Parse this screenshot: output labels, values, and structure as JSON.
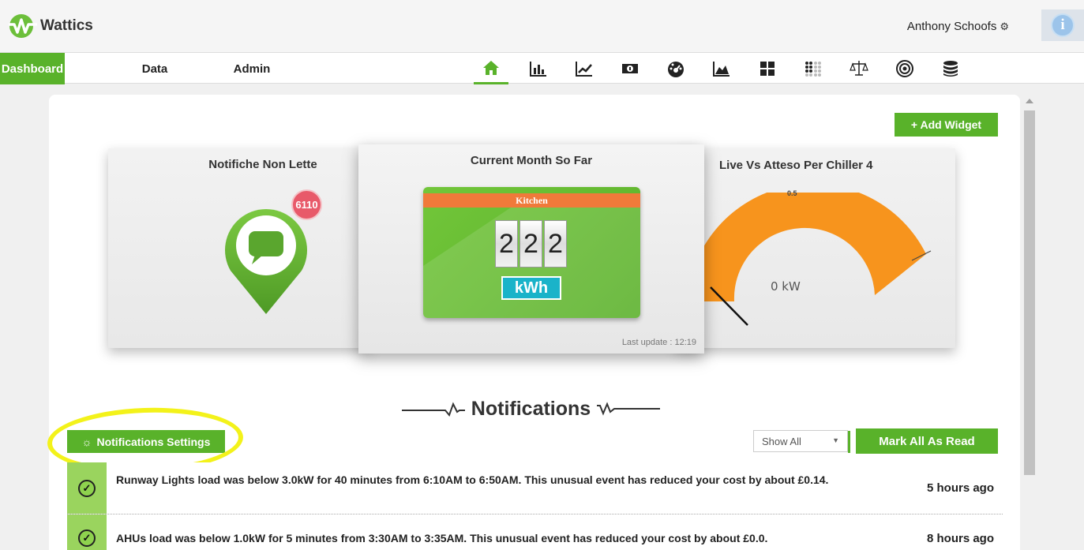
{
  "app": {
    "name": "Wattics"
  },
  "user": {
    "name": "Anthony Schoofs"
  },
  "colors": {
    "brand_green": "#59b22a",
    "accent_orange": "#f7941d",
    "badge_red": "#e85a6a",
    "unit_cyan": "#1ab3c9"
  },
  "nav": {
    "tabs": [
      {
        "label": "Dashboard",
        "active": true
      },
      {
        "label": "Data",
        "active": false
      },
      {
        "label": "Admin",
        "active": false
      }
    ],
    "icons": [
      "home-icon",
      "bar-chart-icon",
      "line-chart-icon",
      "money-icon",
      "dashboard-icon",
      "area-chart-icon",
      "grid-icon",
      "dots-grid-icon",
      "balance-scale-icon",
      "target-icon",
      "database-icon"
    ]
  },
  "toolbar": {
    "add_widget_label": "+ Add Widget"
  },
  "widgets": {
    "unread": {
      "title": "Notifiche Non Lette",
      "count": "6110"
    },
    "month": {
      "title": "Current Month So Far",
      "location": "Kitchen",
      "digits": [
        "2",
        "2",
        "2"
      ],
      "unit": "kWh",
      "last_update": "Last update : 12:19"
    },
    "chiller": {
      "title": "Live Vs Atteso Per Chiller 4",
      "max_label": "0.5",
      "value": "0 kW"
    }
  },
  "notifications": {
    "title": "Notifications",
    "settings_label": "Notifications Settings",
    "filter_value": "Show All",
    "mark_all_label": "Mark All As Read",
    "items": [
      {
        "message": "Runway Lights load was below 3.0kW for 40 minutes from 6:10AM to 6:50AM. This unusual event has reduced your cost by about £0.14.",
        "time": "5 hours ago"
      },
      {
        "message": "AHUs load was below 1.0kW for 5 minutes from 3:30AM to 3:35AM. This unusual event has reduced your cost by about £0.0.",
        "time": "8 hours ago"
      }
    ]
  }
}
